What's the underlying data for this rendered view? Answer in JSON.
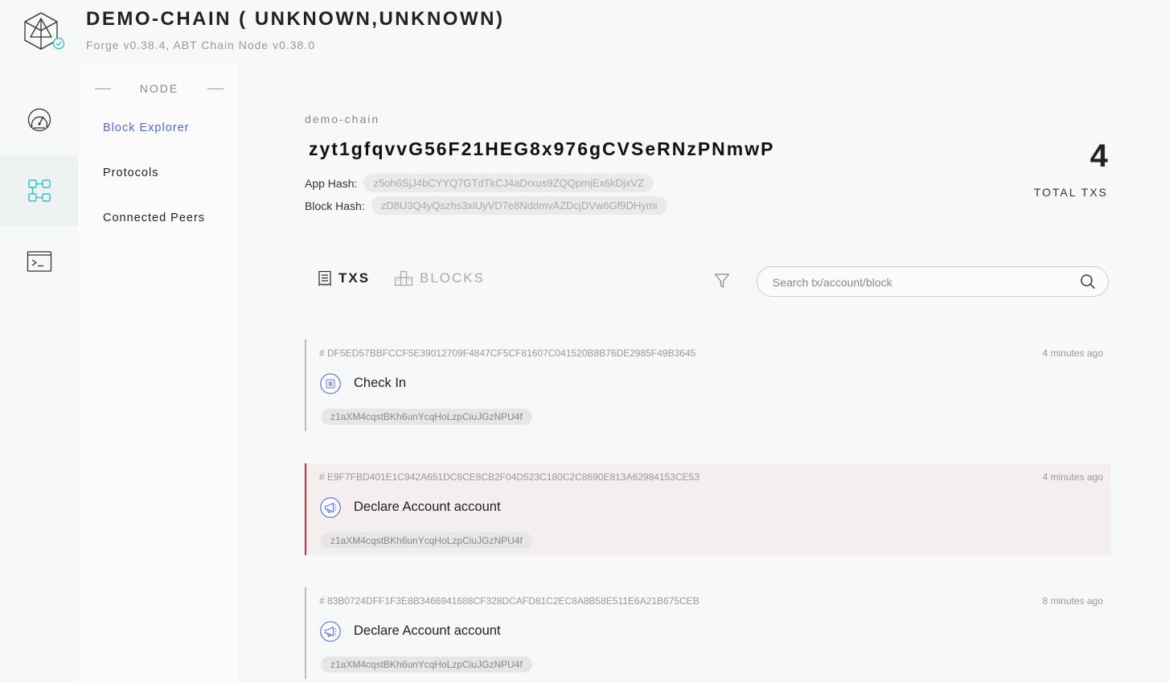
{
  "header": {
    "title": "DEMO-CHAIN ( UNKNOWN,UNKNOWN)",
    "subtitle": "Forge v0.38.4, ABT Chain Node v0.38.0"
  },
  "rail": {
    "items": [
      {
        "icon": "dashboard-icon",
        "active": false
      },
      {
        "icon": "explorer-icon",
        "active": true
      },
      {
        "icon": "terminal-icon",
        "active": false
      }
    ],
    "accent": "#2fbfc6"
  },
  "subnav": {
    "heading": "NODE",
    "items": [
      {
        "label": "Block Explorer",
        "active": true
      },
      {
        "label": "Protocols",
        "active": false
      },
      {
        "label": "Connected Peers",
        "active": false
      }
    ],
    "active_color": "#4a69d8"
  },
  "summary": {
    "chain_id": "demo-chain",
    "node_address": "zyt1gfqvvG56F21HEG8x976gCVSeRNzPNmwP",
    "app_hash_label": "App Hash:",
    "app_hash": "z5oh6SjJ4bCYYQ7GTdTkCJ4aDrxus9ZQQpmjEx6kDjxVZ",
    "block_hash_label": "Block Hash:",
    "block_hash": "zD8U3Q4yQszhs3xiUyVD7e8NddmvAZDcjDVw6Gf9DHymi",
    "total_txs": "4",
    "total_txs_label": "TOTAL TXS"
  },
  "tabs": {
    "txs": "TXS",
    "blocks": "BLOCKS"
  },
  "search": {
    "placeholder": "Search tx/account/block",
    "value": ""
  },
  "transactions": [
    {
      "hash": "# DF5ED57BBFCCF5E39012709F4847CF5CF81607C041520B8B76DE2985F49B3645",
      "time": "4 minutes ago",
      "type": "Check In",
      "icon": "calendar-icon",
      "sender": "z1aXM4cqstBKh6unYcqHoLzpCiuJGzNPU4f",
      "highlighted": false
    },
    {
      "hash": "# E9F7FBD401E1C942A651DC6CE8CB2F04D523C180C2C8690E813A62984153CE53",
      "time": "4 minutes ago",
      "type": "Declare Account account",
      "icon": "megaphone-icon",
      "sender": "z1aXM4cqstBKh6unYcqHoLzpCiuJGzNPU4f",
      "highlighted": true
    },
    {
      "hash": "# 83B0724DFF1F3E8B3466941688CF328DCAFD81C2EC8A8B58E511E6A21B675CEB",
      "time": "8 minutes ago",
      "type": "Declare Account account",
      "icon": "megaphone-icon",
      "sender": "z1aXM4cqstBKh6unYcqHoLzpCiuJGzNPU4f",
      "highlighted": false
    }
  ],
  "colors": {
    "highlight_border": "#cc2d3a",
    "highlight_bg": "#f4eeee",
    "tx_icon": "#5a6fe0"
  }
}
